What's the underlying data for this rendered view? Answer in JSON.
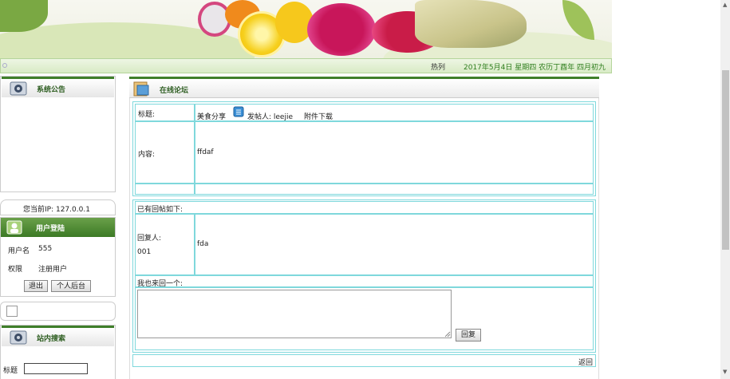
{
  "topbar": {
    "hot_label": "热列",
    "date_text": "2017年5月4日 星期四 农历丁酉年 四月初九"
  },
  "left": {
    "notice_title": "系统公告",
    "ip_text": "您当前IP: 127.0.0.1",
    "login_title": "用户登陆",
    "username_label": "用户名",
    "username_value": "555",
    "role_label": "权限",
    "role_value": "注册用户",
    "logout_label": "退出",
    "backend_label": "个人后台",
    "search_title": "站内搜索",
    "search_field_label": "标题"
  },
  "main": {
    "section_title": "在线论坛",
    "post": {
      "title_label": "标题:",
      "title_value": "美食分享",
      "poster_label": "发帖人: leejie",
      "attachment_label": "附件下载",
      "content_label": "内容:",
      "content_value": "ffdaf"
    },
    "replies": {
      "header": "已有回帖如下:",
      "replier_label": "回复人:",
      "replier_value": "001",
      "reply_content": "fda"
    },
    "reply_form": {
      "label": "我也来回一个:",
      "submit_label": "回复"
    },
    "back_label": "返回"
  },
  "colors": {
    "brand_green": "#3f7f2a",
    "table_border": "#7fd8dc",
    "date_green": "#2e7d1e"
  }
}
